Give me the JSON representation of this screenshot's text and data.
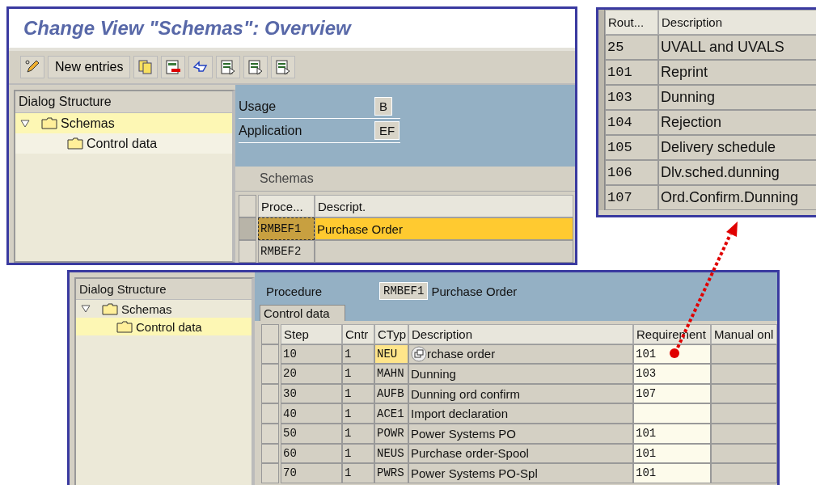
{
  "overview_window": {
    "title": "Change View \"Schemas\": Overview",
    "toolbar": {
      "new_entries": "New entries"
    },
    "dialog_structure": {
      "title": "Dialog Structure",
      "tree": [
        {
          "label": "Schemas",
          "expanded": true,
          "selected": true,
          "children": [
            {
              "label": "Control data",
              "selected": false
            }
          ]
        }
      ]
    },
    "fields": [
      {
        "label": "Usage",
        "value": "B"
      },
      {
        "label": "Application",
        "value": "EF"
      }
    ],
    "schemas_table": {
      "title": "Schemas",
      "columns": [
        "Proce...",
        "Descript."
      ],
      "rows": [
        {
          "procedure": "RMBEF1",
          "description": "Purchase Order",
          "selected": true
        },
        {
          "procedure": "RMBEF2",
          "selected": false
        }
      ]
    }
  },
  "routines_window": {
    "columns": [
      "Rout...",
      "Description"
    ],
    "rows": [
      {
        "routine": "25",
        "description": "UVALL and UVALS"
      },
      {
        "routine": "101",
        "description": "Reprint"
      },
      {
        "routine": "103",
        "description": "Dunning"
      },
      {
        "routine": "104",
        "description": "Rejection"
      },
      {
        "routine": "105",
        "description": "Delivery schedule"
      },
      {
        "routine": "106",
        "description": "Dlv.sched.dunning"
      },
      {
        "routine": "107",
        "description": "Ord.Confirm.Dunning"
      }
    ]
  },
  "control_window": {
    "dialog_structure": {
      "title": "Dialog Structure",
      "tree": [
        {
          "label": "Schemas",
          "expanded": true,
          "selected": false,
          "children": [
            {
              "label": "Control data",
              "selected": true
            }
          ]
        }
      ]
    },
    "procedure": {
      "label": "Procedure",
      "value": "RMBEF1",
      "description": "Purchase Order"
    },
    "tab": "Control data",
    "table": {
      "columns": [
        "Step",
        "Cntr",
        "CTyp",
        "Description",
        "Requirement",
        "Manual onl"
      ],
      "rows": [
        {
          "step": "10",
          "counter": "1",
          "type": "NEU",
          "description": "rchase order",
          "requirement": "101",
          "focused": true
        },
        {
          "step": "20",
          "counter": "1",
          "type": "MAHN",
          "description": "Dunning",
          "requirement": "103",
          "focused": false
        },
        {
          "step": "30",
          "counter": "1",
          "type": "AUFB",
          "description": "Dunning ord confirm",
          "requirement": "107",
          "focused": false
        },
        {
          "step": "40",
          "counter": "1",
          "type": "ACE1",
          "description": "Import declaration",
          "focused": false
        },
        {
          "step": "50",
          "counter": "1",
          "type": "POWR",
          "description": "Power Systems PO",
          "requirement": "101",
          "focused": false
        },
        {
          "step": "60",
          "counter": "1",
          "type": "NEUS",
          "description": "Purchase order-Spool",
          "requirement": "101",
          "focused": false
        },
        {
          "step": "70",
          "counter": "1",
          "type": "PWRS",
          "description": "Power Systems PO-Spl",
          "requirement": "101",
          "focused": false
        }
      ]
    }
  }
}
